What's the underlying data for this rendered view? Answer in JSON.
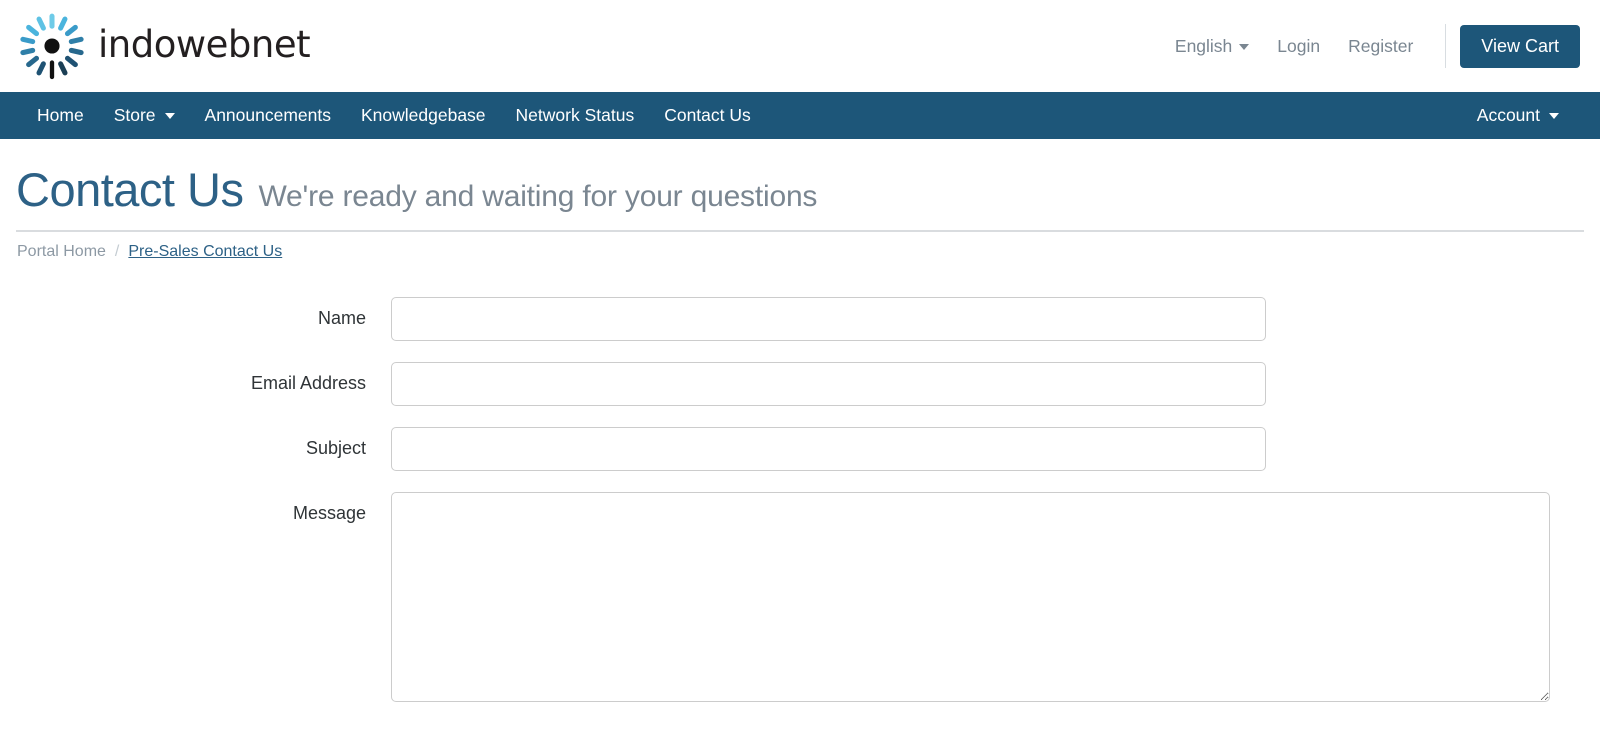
{
  "brand": {
    "name": "indowebnet",
    "logo_icon": "radial-burst-logo-icon",
    "colors": [
      "#6ecbe8",
      "#4bb4dd",
      "#3a9bc9",
      "#2f7fa8",
      "#265f80",
      "#1b3f55",
      "#111111"
    ]
  },
  "topbar": {
    "language": "English",
    "login": "Login",
    "register": "Register",
    "cart_button": "View Cart"
  },
  "nav": {
    "items": [
      {
        "label": "Home",
        "has_caret": false
      },
      {
        "label": "Store",
        "has_caret": true
      },
      {
        "label": "Announcements",
        "has_caret": false
      },
      {
        "label": "Knowledgebase",
        "has_caret": false
      },
      {
        "label": "Network Status",
        "has_caret": false
      },
      {
        "label": "Contact Us",
        "has_caret": false
      }
    ],
    "account": "Account"
  },
  "page": {
    "title": "Contact Us",
    "subtitle": "We're ready and waiting for your questions"
  },
  "breadcrumb": {
    "home": "Portal Home",
    "separator": "/",
    "current": "Pre-Sales Contact Us"
  },
  "form": {
    "name_label": "Name",
    "name_value": "",
    "email_label": "Email Address",
    "email_value": "",
    "subject_label": "Subject",
    "subject_value": "",
    "message_label": "Message",
    "message_value": ""
  },
  "theme": {
    "primary": "#1d5679",
    "title_blue": "#2d6186",
    "muted_gray": "#7a8691",
    "border_gray": "#cccccc"
  }
}
